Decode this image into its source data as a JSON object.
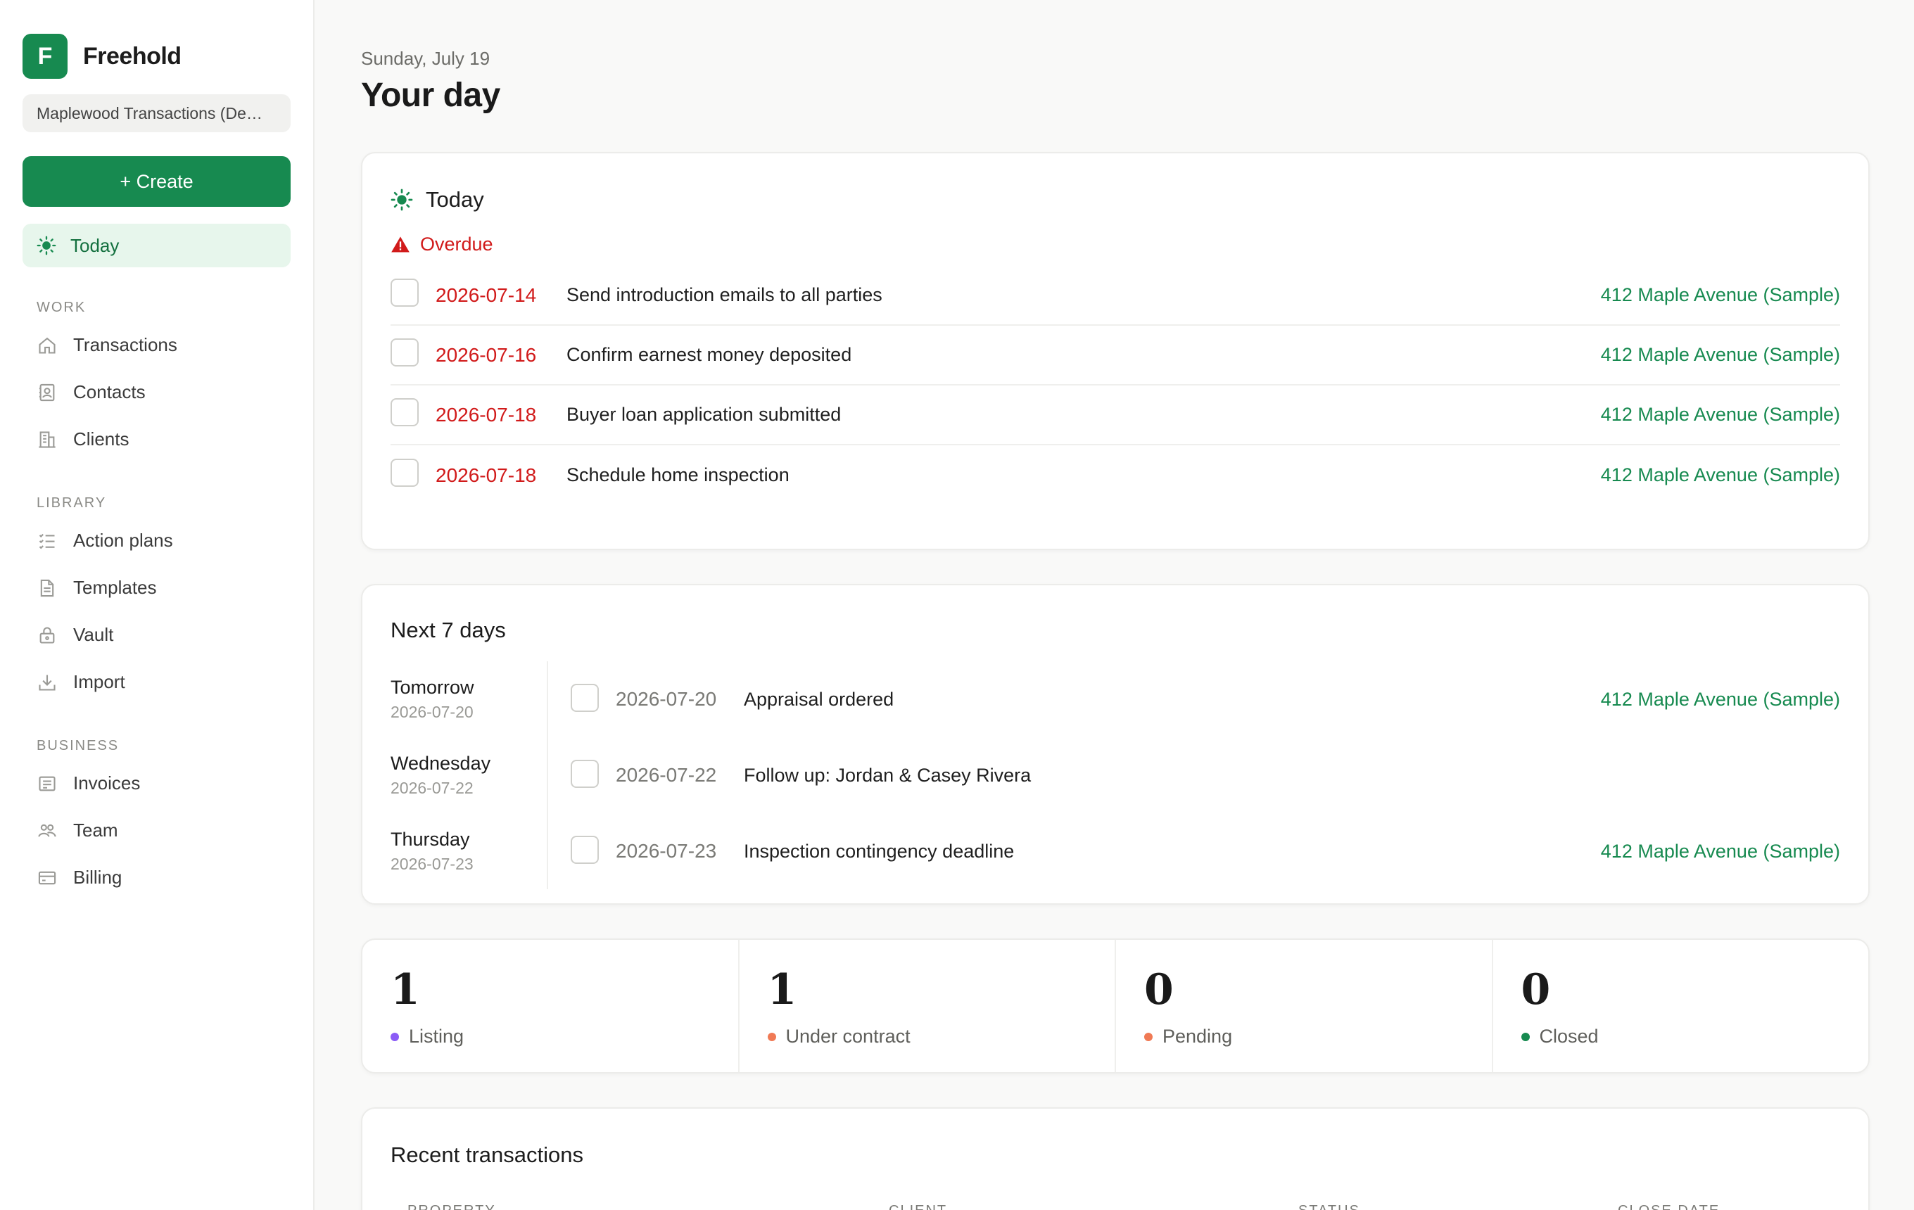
{
  "brand": {
    "logo_letter": "F",
    "name": "Freehold"
  },
  "workspace": {
    "name": "Maplewood Transactions (De…"
  },
  "sidebar": {
    "create_label": "+ Create",
    "today_label": "Today",
    "sections": [
      {
        "label": "WORK",
        "items": [
          {
            "label": "Transactions",
            "icon": "home-icon"
          },
          {
            "label": "Contacts",
            "icon": "contact-card-icon"
          },
          {
            "label": "Clients",
            "icon": "building-icon"
          }
        ]
      },
      {
        "label": "LIBRARY",
        "items": [
          {
            "label": "Action plans",
            "icon": "checklist-icon"
          },
          {
            "label": "Templates",
            "icon": "document-icon"
          },
          {
            "label": "Vault",
            "icon": "lock-icon"
          },
          {
            "label": "Import",
            "icon": "download-icon"
          }
        ]
      },
      {
        "label": "BUSINESS",
        "items": [
          {
            "label": "Invoices",
            "icon": "invoice-icon"
          },
          {
            "label": "Team",
            "icon": "team-icon"
          },
          {
            "label": "Billing",
            "icon": "card-icon"
          }
        ]
      }
    ]
  },
  "header": {
    "date": "Sunday, July 19",
    "title": "Your day"
  },
  "today_card": {
    "title": "Today",
    "overdue_label": "Overdue",
    "tasks": [
      {
        "date": "2026-07-14",
        "title": "Send introduction emails to all parties",
        "link": "412 Maple Avenue (Sample)"
      },
      {
        "date": "2026-07-16",
        "title": "Confirm earnest money deposited",
        "link": "412 Maple Avenue (Sample)"
      },
      {
        "date": "2026-07-18",
        "title": "Buyer loan application submitted",
        "link": "412 Maple Avenue (Sample)"
      },
      {
        "date": "2026-07-18",
        "title": "Schedule home inspection",
        "link": "412 Maple Avenue (Sample)"
      }
    ]
  },
  "next_card": {
    "title": "Next 7 days",
    "rows": [
      {
        "day": "Tomorrow",
        "day_date": "2026-07-20",
        "date": "2026-07-20",
        "title": "Appraisal ordered",
        "link": "412 Maple Avenue (Sample)"
      },
      {
        "day": "Wednesday",
        "day_date": "2026-07-22",
        "date": "2026-07-22",
        "title": "Follow up: Jordan & Casey Rivera",
        "link": ""
      },
      {
        "day": "Thursday",
        "day_date": "2026-07-23",
        "date": "2026-07-23",
        "title": "Inspection contingency deadline",
        "link": "412 Maple Avenue (Sample)"
      }
    ]
  },
  "stats": [
    {
      "value": "1",
      "label": "Listing",
      "color": "#8b5cf6"
    },
    {
      "value": "1",
      "label": "Under contract",
      "color": "#f07a55"
    },
    {
      "value": "0",
      "label": "Pending",
      "color": "#f07a55"
    },
    {
      "value": "0",
      "label": "Closed",
      "color": "#178a50"
    }
  ],
  "recent": {
    "title": "Recent transactions",
    "columns": [
      "PROPERTY",
      "CLIENT",
      "STATUS",
      "CLOSE DATE"
    ]
  },
  "colors": {
    "accent": "#178a50",
    "overdue": "#d11a1a"
  }
}
